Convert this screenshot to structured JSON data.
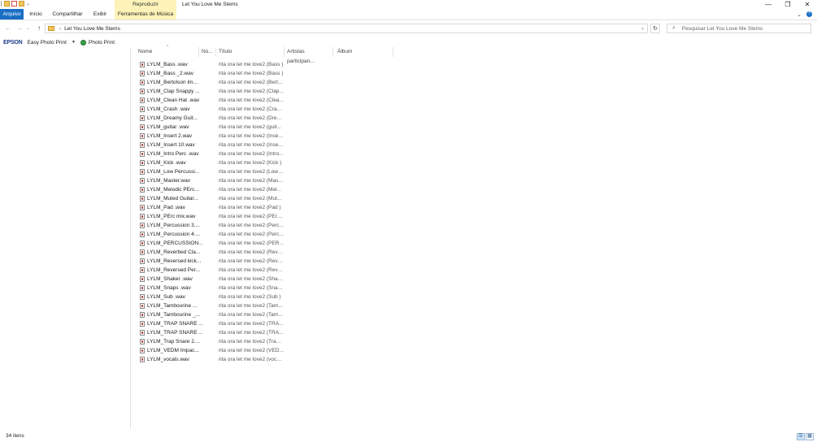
{
  "window": {
    "title": "Let You Love Me Stems",
    "context_tab_group": "Reproduzir",
    "controls": {
      "minimize": "—",
      "maximize": "❐",
      "close": "✕"
    }
  },
  "ribbon": {
    "tabs": [
      {
        "label": "Arquivo",
        "active": true
      },
      {
        "label": "Início"
      },
      {
        "label": "Compartilhar"
      },
      {
        "label": "Exibir"
      },
      {
        "label": "Ferramentas de Música"
      }
    ],
    "expand_glyph": "⌄",
    "help_glyph": "?"
  },
  "address": {
    "path": "Let You Love Me Stems",
    "search_placeholder": "Pesquisar Let You Love Me Stems",
    "back": "←",
    "forward": "→",
    "recent": "⌄",
    "up": "↑",
    "separator": "›",
    "dropdown": "⌄",
    "refresh": "↻",
    "search_glyph": "⌕"
  },
  "epson": {
    "logo": "EPSON",
    "easy_photo_print": "Easy Photo Print",
    "dropdown": "▼",
    "photo_print": "Photo Print"
  },
  "columns": {
    "name": "Nome",
    "num": "Nú...",
    "title": "Título",
    "artists": "Artistas participan...",
    "album": "Álbum",
    "sort_glyph": "^"
  },
  "files": [
    {
      "name": "LYLM_Bass .wav",
      "title": "rita ora let me love2 (Bass )"
    },
    {
      "name": "LYLM_Bass _2.wav",
      "title": "rita ora let me love2 (Bass )"
    },
    {
      "name": "LYLM_Bertolson Im...",
      "title": "rita ora let me love2 (Bert..."
    },
    {
      "name": "LYLM_Clap Snappy ...",
      "title": "rita ora let me love2 (Clap..."
    },
    {
      "name": "LYLM_Clean Hat .wav",
      "title": "rita ora let me love2 (Clea..."
    },
    {
      "name": "LYLM_Crash .wav",
      "title": "rita ora let me love2 (Cras..."
    },
    {
      "name": "LYLM_Dreamy Guit...",
      "title": "rita ora let me love2 (Drea..."
    },
    {
      "name": "LYLM_guitar .wav",
      "title": "rita ora let me love2 (guit..."
    },
    {
      "name": "LYLM_Insert 2.wav",
      "title": "rita ora let me love2 (Inser..."
    },
    {
      "name": "LYLM_Insert 10.wav",
      "title": "rita ora let me love2 (Inser..."
    },
    {
      "name": "LYLM_Intro Perc .wav",
      "title": "rita ora let me love2 (Intro..."
    },
    {
      "name": "LYLM_Kick .wav",
      "title": "rita ora let me love2 (Kick )"
    },
    {
      "name": "LYLM_Low Percussi...",
      "title": "rita ora let me love2 (Low ..."
    },
    {
      "name": "LYLM_Master.wav",
      "title": "rita ora let me love2 (Mast..."
    },
    {
      "name": "LYLM_Melodic PErc...",
      "title": "rita ora let me love2 (Mel..."
    },
    {
      "name": "LYLM_Muted Guitar...",
      "title": "rita ora let me love2 (Mut..."
    },
    {
      "name": "LYLM_Pad .wav",
      "title": "rita ora let me love2 (Pad )"
    },
    {
      "name": "LYLM_PErc mix.wav",
      "title": "rita ora let me love2 (PErc ..."
    },
    {
      "name": "LYLM_Percussion 3....",
      "title": "rita ora let me love2 (Perc..."
    },
    {
      "name": "LYLM_Percussion 4....",
      "title": "rita ora let me love2 (Perc..."
    },
    {
      "name": "LYLM_PERCUSSION...",
      "title": "rita ora let me love2 (PER..."
    },
    {
      "name": "LYLM_Reverbed Cla...",
      "title": "rita ora let me love2 (Reve..."
    },
    {
      "name": "LYLM_Reversed kick...",
      "title": "rita ora let me love2 (Reve..."
    },
    {
      "name": "LYLM_Reversed Per...",
      "title": "rita ora let me love2 (Reve..."
    },
    {
      "name": "LYLM_Shaker .wav",
      "title": "rita ora let me love2 (Shak..."
    },
    {
      "name": "LYLM_Snaps .wav",
      "title": "rita ora let me love2 (Snap..."
    },
    {
      "name": "LYLM_Sub .wav",
      "title": "rita ora let me love2 (Sub )"
    },
    {
      "name": "LYLM_Tambourine ...",
      "title": "rita ora let me love2 (Tam..."
    },
    {
      "name": "LYLM_Tambourine _...",
      "title": "rita ora let me love2 (Tam..."
    },
    {
      "name": "LYLM_TRAP SNARE ...",
      "title": "rita ora let me love2 (TRA..."
    },
    {
      "name": "LYLM_TRAP SNARE ...",
      "title": "rita ora let me love2 (TRA..."
    },
    {
      "name": "LYLM_Trap Snare 2....",
      "title": "rita ora let me love2 (Trap ..."
    },
    {
      "name": "LYLM_VEDM Impac...",
      "title": "rita ora let me love2 (VED..."
    },
    {
      "name": "LYLM_vocals.wav",
      "title": "rita ora let me love2 (voca..."
    }
  ],
  "status": {
    "item_count": "34 itens",
    "details_view_glyph": "☰",
    "tiles_view_glyph": "▦"
  },
  "icons": {
    "file": "audio-file-icon",
    "folder": "folder-icon",
    "search": "search-icon",
    "refresh": "refresh-icon",
    "help": "help-icon"
  },
  "colors": {
    "file_tab": "#1a6fc4",
    "context_tab": "#fdf3b8",
    "epson_blue": "#1a3a8c"
  }
}
